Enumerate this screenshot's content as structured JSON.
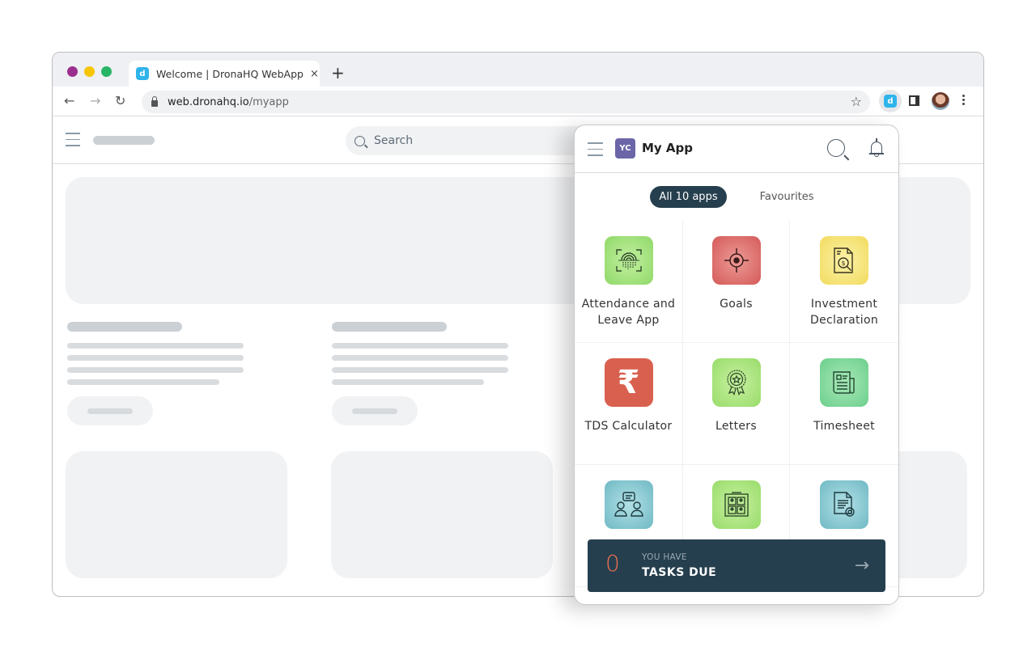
{
  "browser": {
    "tab_title": "Welcome | DronaHQ WebApp",
    "tab_close": "×",
    "new_tab": "+",
    "url_host": "web.dronahq.io",
    "url_path": "/myapp",
    "favicon_glyph": "d",
    "nav": {
      "back": "←",
      "forward": "→",
      "reload": "↻",
      "bookmark": "☆"
    }
  },
  "page": {
    "search_placeholder": "Search"
  },
  "popup": {
    "badge": "YC",
    "title": "My App",
    "tabs": [
      {
        "label": "All 10 apps",
        "active": true
      },
      {
        "label": "Favourites",
        "active": false
      }
    ],
    "apps": [
      {
        "label": "Attendance and Leave App",
        "icon": "fingerprint-icon",
        "color": "#9fe07a"
      },
      {
        "label": "Goals",
        "icon": "target-icon",
        "color": "#d9605f"
      },
      {
        "label": "Investment Declaration",
        "icon": "investment-document-icon",
        "color": "#f5e27a"
      },
      {
        "label": "TDS Calculator",
        "icon": "rupee-icon",
        "color": "#d9604f",
        "glyph": "₹"
      },
      {
        "label": "Letters",
        "icon": "award-badge-icon",
        "color": "#a8e07a"
      },
      {
        "label": "Timesheet",
        "icon": "newspaper-icon",
        "color": "#7ed69a"
      },
      {
        "label": "",
        "icon": "people-chat-icon",
        "color": "#7fc3cc"
      },
      {
        "label": "",
        "icon": "directory-board-icon",
        "color": "#a8e07a"
      },
      {
        "label": "",
        "icon": "document-search-icon",
        "color": "#7fc3cc"
      }
    ],
    "tasks": {
      "count": "0",
      "pre": "YOU HAVE",
      "label": "TASKS DUE",
      "arrow": "→"
    }
  }
}
